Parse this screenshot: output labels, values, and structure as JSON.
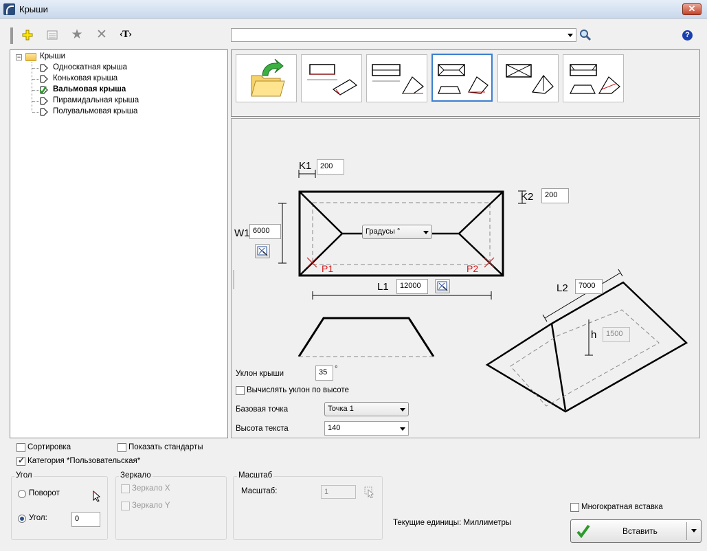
{
  "window": {
    "title": "Крыши"
  },
  "toolbar": {
    "search_value": "",
    "text_btn_label": "‹T›",
    "help_label": "?"
  },
  "tree": {
    "root": "Крыши",
    "items": [
      {
        "label": "Односкатная крыша",
        "bold": false
      },
      {
        "label": "Коньковая крыша",
        "bold": false
      },
      {
        "label": "Вальмовая крыша",
        "bold": true
      },
      {
        "label": "Пирамидальная крыша",
        "bold": false
      },
      {
        "label": "Полувальмовая крыша",
        "bold": false
      }
    ]
  },
  "drawing": {
    "k1_label": "K1",
    "k1_value": "200",
    "k2_label": "K2",
    "k2_value": "200",
    "w1_label": "W1",
    "w1_value": "6000",
    "l1_label": "L1",
    "l1_value": "12000",
    "l2_label": "L2",
    "l2_value": "7000",
    "h_label": "h",
    "h_value": "1500",
    "p1_label": "P1",
    "p2_label": "P2",
    "angle_unit": "Градусы °"
  },
  "params": {
    "slope_label": "Уклон крыши",
    "slope_value": "35",
    "slope_unit": "°",
    "calc_slope_label": "Вычислять уклон по высоте",
    "base_point_label": "Базовая точка",
    "base_point_value": "Точка 1",
    "text_height_label": "Высота текста",
    "text_height_value": "140"
  },
  "options": {
    "sort_label": "Сортировка",
    "show_std_label": "Показать стандарты",
    "category_label": "Категория *Пользовательская*"
  },
  "angle_group": {
    "title": "Угол",
    "rotate_label": "Поворот",
    "angle_label": "Угол:",
    "angle_value": "0"
  },
  "mirror_group": {
    "title": "Зеркало",
    "mirror_x": "Зеркало X",
    "mirror_y": "Зеркало Y"
  },
  "scale_group": {
    "title": "Масштаб",
    "scale_label": "Масштаб:",
    "scale_value": "1"
  },
  "footer": {
    "units_text": "Текущие единицы: Миллиметры",
    "multi_insert_label": "Многократная вставка",
    "insert_label": "Вставить"
  },
  "colors": {
    "accent": "#3c7fd0",
    "marker_red": "#d01818",
    "check_green": "#2a9a2a"
  }
}
